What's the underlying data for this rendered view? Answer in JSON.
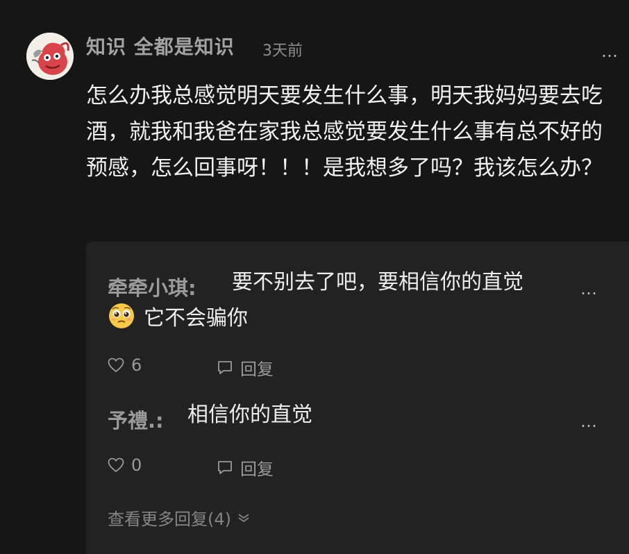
{
  "post": {
    "username": "知识 全都是知识",
    "time": "3天前",
    "more": "…",
    "content": "怎么办我总感觉明天要发生什么事，明天我妈妈要去吃酒，就我和我爸在家我总感觉要发生什么事有总不好的预感，怎么回事呀！！！是我想多了吗？我该怎么办？"
  },
  "replies": [
    {
      "name": "牵牵小琪:",
      "text_line1": "要不别去了吧，要相信你的直觉",
      "emoji": "pleading-face-icon",
      "text_line2": "它不会骗你",
      "more": "…",
      "likes": "6",
      "reply_label": "回复"
    },
    {
      "name": "予禮.:",
      "text_line1": "相信你的直觉",
      "more": "…",
      "likes": "0",
      "reply_label": "回复"
    }
  ],
  "view_more": "查看更多回复(4)",
  "colors": {
    "background": "#161616",
    "reply_panel": "#222222",
    "text_primary": "#f1f1f1",
    "text_muted": "#9b9b9b"
  }
}
